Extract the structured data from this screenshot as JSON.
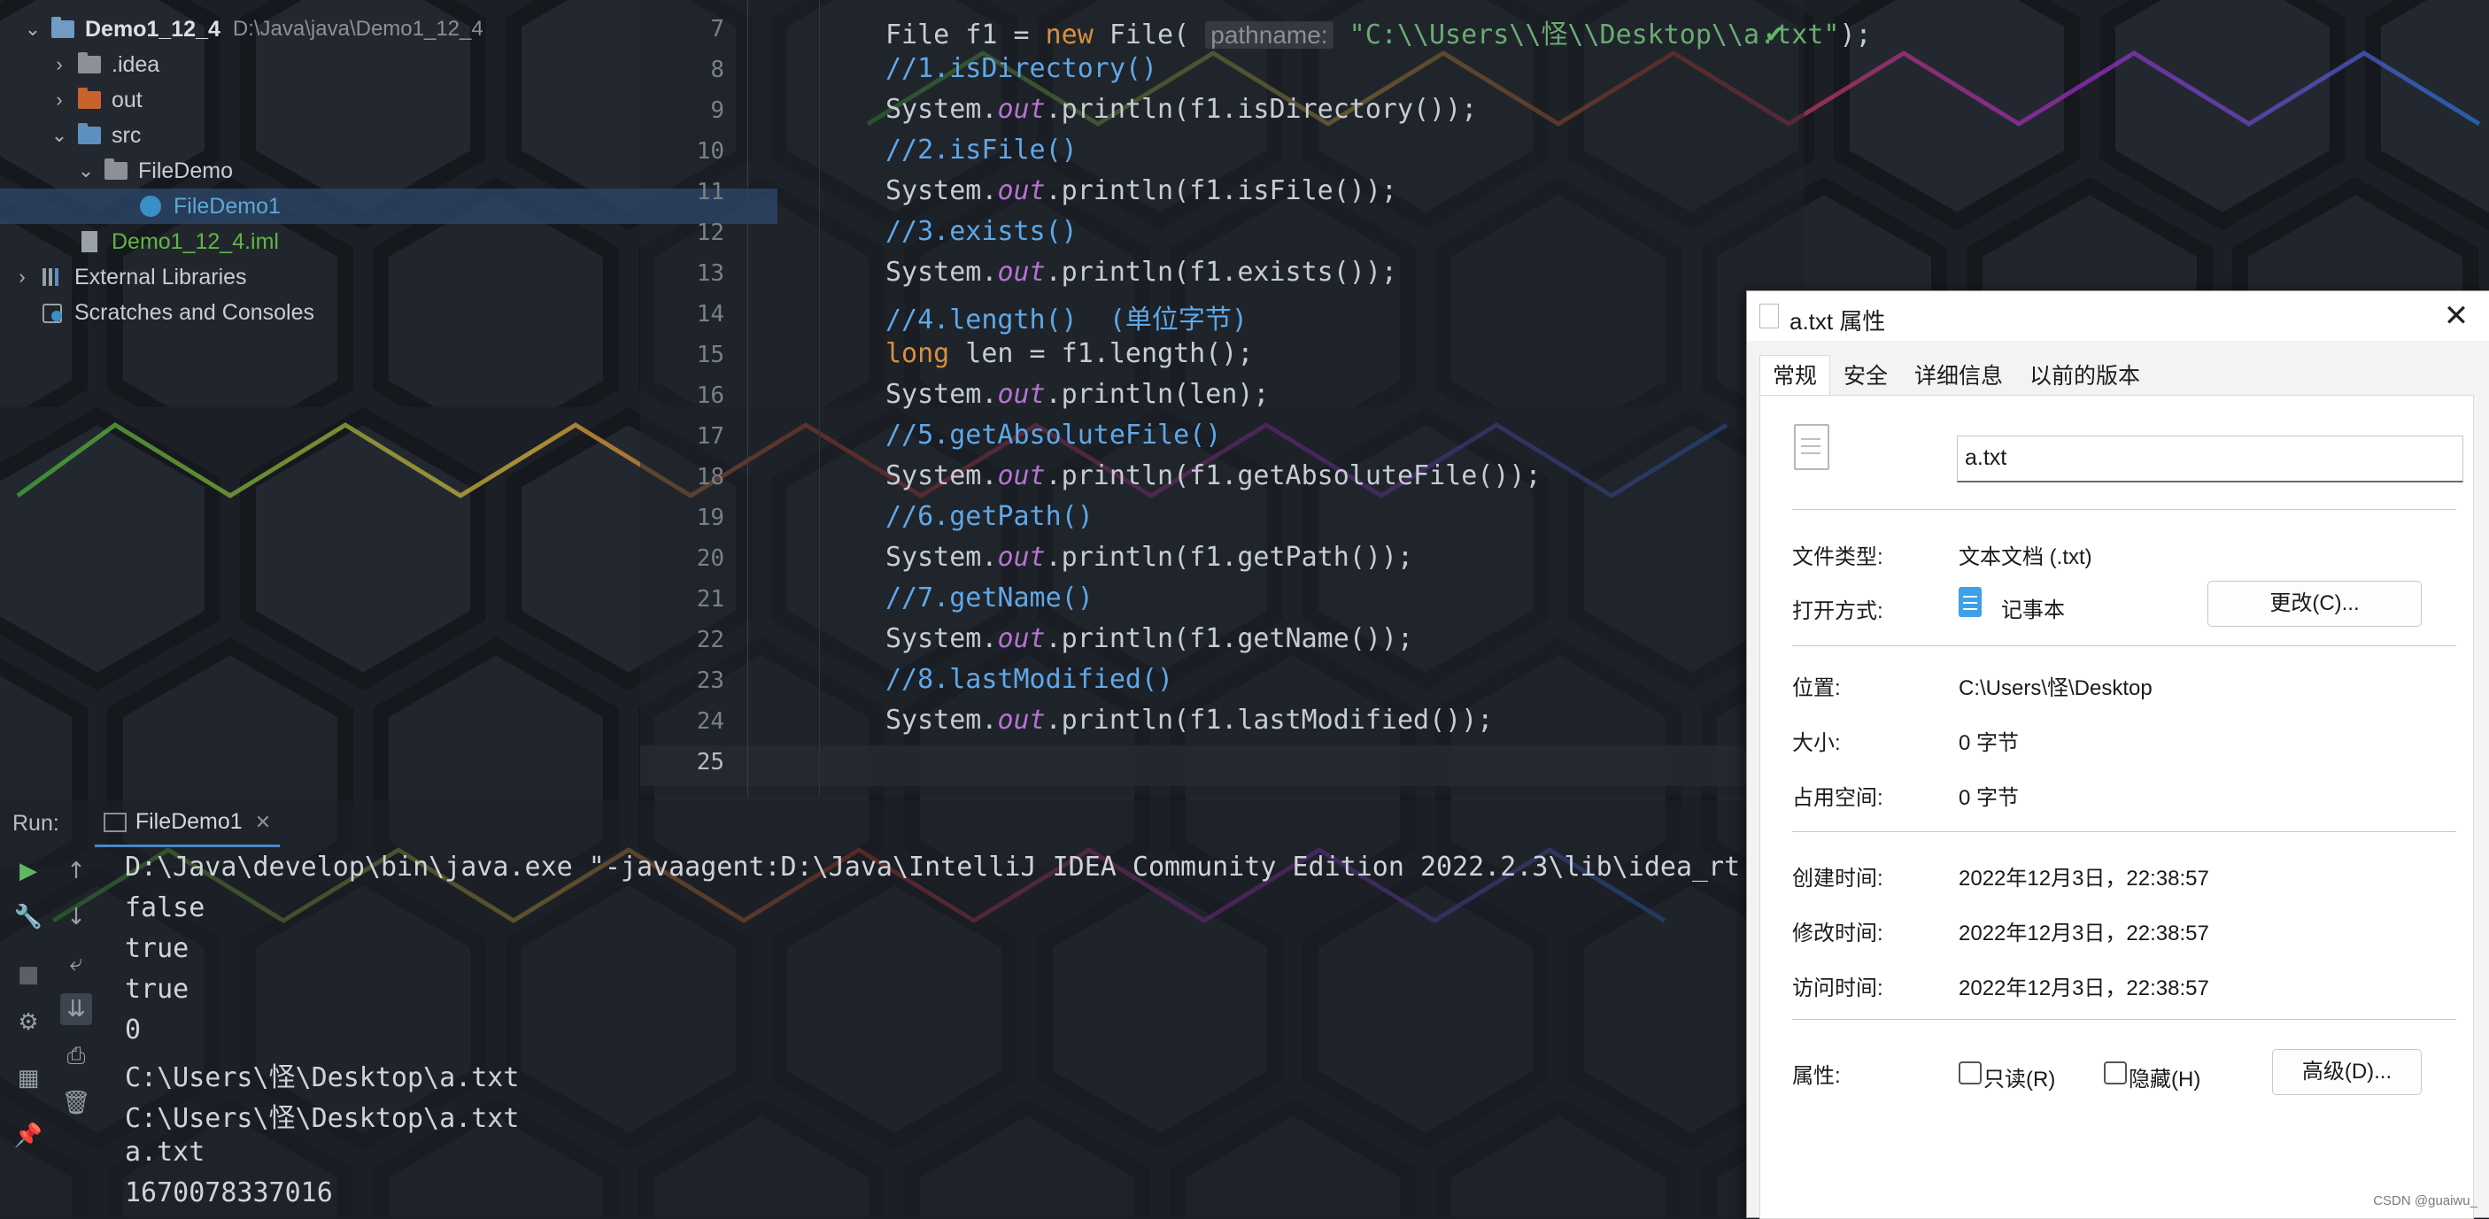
{
  "project_tree": {
    "items": [
      {
        "label": "Demo1_12_4",
        "sub": "D:\\Java\\java\\Demo1_12_4",
        "icon": "module-folder-icon",
        "expanded": true
      },
      {
        "label": ".idea",
        "icon": "folder-icon",
        "expanded": false
      },
      {
        "label": "out",
        "icon": "folder-icon",
        "expanded": false
      },
      {
        "label": "src",
        "icon": "source-folder-icon",
        "expanded": true
      },
      {
        "label": "FileDemo",
        "icon": "package-icon",
        "expanded": true
      },
      {
        "label": "FileDemo1",
        "icon": "java-class-icon",
        "selected": true
      },
      {
        "label": "Demo1_12_4.iml",
        "icon": "iml-file-icon"
      },
      {
        "label": "External Libraries",
        "icon": "libraries-icon",
        "expanded": false
      },
      {
        "label": "Scratches and Consoles",
        "icon": "scratches-icon"
      }
    ]
  },
  "editor": {
    "line_numbers": [
      "7",
      "8",
      "9",
      "10",
      "11",
      "12",
      "13",
      "14",
      "15",
      "16",
      "17",
      "18",
      "19",
      "20",
      "21",
      "22",
      "23",
      "24",
      "25"
    ],
    "current_line": "25",
    "lines": [
      {
        "parts": [
          [
            "",
            "File f1 = "
          ],
          [
            "kw",
            "new"
          ],
          [
            "",
            " File( "
          ],
          [
            "hint",
            "pathname:"
          ],
          [
            "",
            " "
          ],
          [
            "st",
            "\"C:\\\\Users\\\\怪\\\\Desktop\\\\a.txt\""
          ],
          [
            "",
            ");"
          ]
        ]
      },
      {
        "parts": [
          [
            "cm",
            "//1.isDirectory()"
          ]
        ]
      },
      {
        "parts": [
          [
            "",
            "System."
          ],
          [
            "it",
            "out"
          ],
          [
            "",
            ".println(f1.isDirectory());"
          ]
        ]
      },
      {
        "parts": [
          [
            "cm",
            "//2.isFile()"
          ]
        ]
      },
      {
        "parts": [
          [
            "",
            "System."
          ],
          [
            "it",
            "out"
          ],
          [
            "",
            ".println(f1.isFile());"
          ]
        ]
      },
      {
        "parts": [
          [
            "cm",
            "//3.exists()"
          ]
        ]
      },
      {
        "parts": [
          [
            "",
            "System."
          ],
          [
            "it",
            "out"
          ],
          [
            "",
            ".println(f1.exists());"
          ]
        ]
      },
      {
        "parts": [
          [
            "cm",
            "//4.length()  (单位字节)"
          ]
        ]
      },
      {
        "parts": [
          [
            "kw",
            "long"
          ],
          [
            "",
            " len = f1.length();"
          ]
        ]
      },
      {
        "parts": [
          [
            "",
            "System."
          ],
          [
            "it",
            "out"
          ],
          [
            "",
            ".println(len);"
          ]
        ]
      },
      {
        "parts": [
          [
            "cm",
            "//5.getAbsoluteFile()"
          ]
        ]
      },
      {
        "parts": [
          [
            "",
            "System."
          ],
          [
            "it",
            "out"
          ],
          [
            "",
            ".println(f1.getAbsoluteFile());"
          ]
        ]
      },
      {
        "parts": [
          [
            "cm",
            "//6.getPath()"
          ]
        ]
      },
      {
        "parts": [
          [
            "",
            "System."
          ],
          [
            "it",
            "out"
          ],
          [
            "",
            ".println(f1.getPath());"
          ]
        ]
      },
      {
        "parts": [
          [
            "cm",
            "//7.getName()"
          ]
        ]
      },
      {
        "parts": [
          [
            "",
            "System."
          ],
          [
            "it",
            "out"
          ],
          [
            "",
            ".println(f1.getName());"
          ]
        ]
      },
      {
        "parts": [
          [
            "cm",
            "//8.lastModified()"
          ]
        ]
      },
      {
        "parts": [
          [
            "",
            "System."
          ],
          [
            "it",
            "out"
          ],
          [
            "",
            ".println(f1.lastModified());"
          ]
        ]
      },
      {
        "parts": []
      }
    ]
  },
  "run": {
    "label": "Run:",
    "tab": "FileDemo1",
    "console": [
      "D:\\Java\\develop\\bin\\java.exe \"-javaagent:D:\\Java\\IntelliJ IDEA Community Edition 2022.2.3\\lib\\idea_rt.",
      "false",
      "true",
      "true",
      "0",
      "C:\\Users\\怪\\Desktop\\a.txt",
      "C:\\Users\\怪\\Desktop\\a.txt",
      "a.txt",
      "1670078337016"
    ]
  },
  "dialog": {
    "title": "a.txt 属性",
    "tabs": [
      "常规",
      "安全",
      "详细信息",
      "以前的版本"
    ],
    "active_tab": "常规",
    "file_name": "a.txt",
    "type_label": "文件类型:",
    "type_value": "文本文档 (.txt)",
    "open_label": "打开方式:",
    "open_value": "记事本",
    "change_button": "更改(C)...",
    "location_label": "位置:",
    "location_value": "C:\\Users\\怪\\Desktop",
    "size_label": "大小:",
    "size_value": "0 字节",
    "disk_label": "占用空间:",
    "disk_value": "0 字节",
    "created_label": "创建时间:",
    "created_value": "2022年12月3日，22:38:57",
    "modified_label": "修改时间:",
    "modified_value": "2022年12月3日，22:38:57",
    "accessed_label": "访问时间:",
    "accessed_value": "2022年12月3日，22:38:57",
    "attr_label": "属性:",
    "readonly_label": "只读(R)",
    "hidden_label": "隐藏(H)",
    "advanced_button": "高级(D)...",
    "watermark": "CSDN @guaiwu_"
  }
}
